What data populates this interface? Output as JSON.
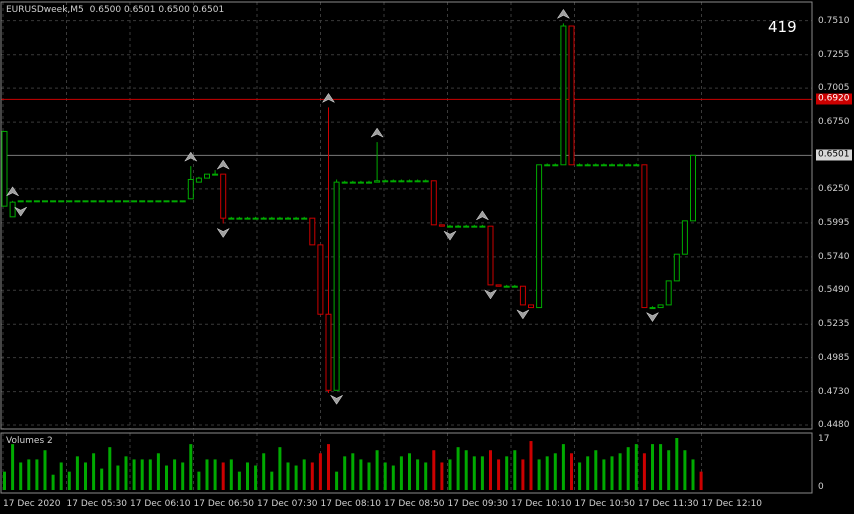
{
  "header": {
    "symbol": "EURUSDweek,M5",
    "ohlc": "0.6500 0.6501 0.6500 0.6501",
    "timer": "419"
  },
  "volume_panel": {
    "title": "Volumes 2",
    "scale": [
      "17",
      "0"
    ]
  },
  "price_axis": {
    "ticks": [
      "0.7510",
      "0.7255",
      "0.7005",
      "0.6750",
      "0.6250",
      "0.5995",
      "0.5740",
      "0.5490",
      "0.5235",
      "0.4985",
      "0.4730",
      "0.4480"
    ],
    "red_line_label": "0.6920",
    "current_price_label": "0.6501"
  },
  "time_axis": {
    "labels": [
      "17 Dec 2020",
      "17 Dec 05:30",
      "17 Dec 06:10",
      "17 Dec 06:50",
      "17 Dec 07:30",
      "17 Dec 08:10",
      "17 Dec 08:50",
      "17 Dec 09:30",
      "17 Dec 10:10",
      "17 Dec 10:50",
      "17 Dec 11:30",
      "17 Dec 12:10"
    ]
  },
  "colors": {
    "background": "#000000",
    "grid": "#3a3a3a",
    "bull": "#00aa00",
    "bear": "#cc0000",
    "red_line": "#cc0000",
    "current_line": "#7a7a7a",
    "fractal": "#a0a0a0"
  },
  "chart_data": [
    {
      "type": "candlestick",
      "title": "EURUSDweek,M5",
      "ylim": [
        0.445,
        0.765
      ],
      "horizontal_lines": [
        0.692,
        0.6501
      ],
      "candles": [
        {
          "o": 0.612,
          "h": 0.668,
          "l": 0.612,
          "c": 0.668
        },
        {
          "o": 0.604,
          "h": 0.616,
          "l": 0.604,
          "c": 0.615
        },
        {
          "o": 0.616,
          "h": 0.616,
          "l": 0.615,
          "c": 0.616
        },
        {
          "o": 0.616,
          "h": 0.616,
          "l": 0.615,
          "c": 0.616
        },
        {
          "o": 0.616,
          "h": 0.616,
          "l": 0.615,
          "c": 0.616
        },
        {
          "o": 0.616,
          "h": 0.616,
          "l": 0.615,
          "c": 0.616
        },
        {
          "o": 0.616,
          "h": 0.616,
          "l": 0.615,
          "c": 0.616
        },
        {
          "o": 0.616,
          "h": 0.616,
          "l": 0.615,
          "c": 0.616
        },
        {
          "o": 0.616,
          "h": 0.616,
          "l": 0.615,
          "c": 0.616
        },
        {
          "o": 0.616,
          "h": 0.616,
          "l": 0.615,
          "c": 0.616
        },
        {
          "o": 0.616,
          "h": 0.616,
          "l": 0.615,
          "c": 0.616
        },
        {
          "o": 0.616,
          "h": 0.616,
          "l": 0.615,
          "c": 0.616
        },
        {
          "o": 0.616,
          "h": 0.616,
          "l": 0.615,
          "c": 0.616
        },
        {
          "o": 0.616,
          "h": 0.616,
          "l": 0.615,
          "c": 0.616
        },
        {
          "o": 0.616,
          "h": 0.616,
          "l": 0.615,
          "c": 0.616
        },
        {
          "o": 0.616,
          "h": 0.616,
          "l": 0.615,
          "c": 0.616
        },
        {
          "o": 0.616,
          "h": 0.616,
          "l": 0.615,
          "c": 0.616
        },
        {
          "o": 0.616,
          "h": 0.616,
          "l": 0.615,
          "c": 0.616
        },
        {
          "o": 0.616,
          "h": 0.616,
          "l": 0.615,
          "c": 0.616
        },
        {
          "o": 0.616,
          "h": 0.616,
          "l": 0.615,
          "c": 0.616
        },
        {
          "o": 0.616,
          "h": 0.616,
          "l": 0.615,
          "c": 0.616
        },
        {
          "o": 0.616,
          "h": 0.616,
          "l": 0.615,
          "c": 0.616
        },
        {
          "o": 0.616,
          "h": 0.616,
          "l": 0.615,
          "c": 0.616
        },
        {
          "o": 0.6175,
          "h": 0.642,
          "l": 0.6175,
          "c": 0.632
        },
        {
          "o": 0.63,
          "h": 0.634,
          "l": 0.63,
          "c": 0.633
        },
        {
          "o": 0.633,
          "h": 0.636,
          "l": 0.633,
          "c": 0.636
        },
        {
          "o": 0.636,
          "h": 0.639,
          "l": 0.636,
          "c": 0.636
        },
        {
          "o": 0.636,
          "h": 0.636,
          "l": 0.599,
          "c": 0.603
        },
        {
          "o": 0.603,
          "h": 0.604,
          "l": 0.603,
          "c": 0.603
        },
        {
          "o": 0.603,
          "h": 0.604,
          "l": 0.603,
          "c": 0.603
        },
        {
          "o": 0.603,
          "h": 0.604,
          "l": 0.603,
          "c": 0.603
        },
        {
          "o": 0.603,
          "h": 0.604,
          "l": 0.603,
          "c": 0.603
        },
        {
          "o": 0.603,
          "h": 0.604,
          "l": 0.603,
          "c": 0.603
        },
        {
          "o": 0.603,
          "h": 0.604,
          "l": 0.603,
          "c": 0.603
        },
        {
          "o": 0.603,
          "h": 0.604,
          "l": 0.603,
          "c": 0.603
        },
        {
          "o": 0.603,
          "h": 0.604,
          "l": 0.603,
          "c": 0.603
        },
        {
          "o": 0.603,
          "h": 0.604,
          "l": 0.603,
          "c": 0.603
        },
        {
          "o": 0.603,
          "h": 0.604,
          "l": 0.603,
          "c": 0.603
        },
        {
          "o": 0.603,
          "h": 0.603,
          "l": 0.583,
          "c": 0.583
        },
        {
          "o": 0.583,
          "h": 0.583,
          "l": 0.531,
          "c": 0.531
        },
        {
          "o": 0.531,
          "h": 0.686,
          "l": 0.472,
          "c": 0.474
        },
        {
          "o": 0.474,
          "h": 0.632,
          "l": 0.474,
          "c": 0.63
        },
        {
          "o": 0.63,
          "h": 0.631,
          "l": 0.63,
          "c": 0.63
        },
        {
          "o": 0.63,
          "h": 0.631,
          "l": 0.63,
          "c": 0.63
        },
        {
          "o": 0.63,
          "h": 0.631,
          "l": 0.63,
          "c": 0.63
        },
        {
          "o": 0.63,
          "h": 0.631,
          "l": 0.63,
          "c": 0.63
        },
        {
          "o": 0.63,
          "h": 0.66,
          "l": 0.63,
          "c": 0.631
        },
        {
          "o": 0.631,
          "h": 0.632,
          "l": 0.63,
          "c": 0.631
        },
        {
          "o": 0.631,
          "h": 0.632,
          "l": 0.63,
          "c": 0.631
        },
        {
          "o": 0.631,
          "h": 0.632,
          "l": 0.63,
          "c": 0.631
        },
        {
          "o": 0.631,
          "h": 0.632,
          "l": 0.63,
          "c": 0.631
        },
        {
          "o": 0.631,
          "h": 0.632,
          "l": 0.63,
          "c": 0.631
        },
        {
          "o": 0.631,
          "h": 0.632,
          "l": 0.63,
          "c": 0.631
        },
        {
          "o": 0.631,
          "h": 0.631,
          "l": 0.598,
          "c": 0.598
        },
        {
          "o": 0.598,
          "h": 0.598,
          "l": 0.597,
          "c": 0.597
        },
        {
          "o": 0.597,
          "h": 0.598,
          "l": 0.597,
          "c": 0.597
        },
        {
          "o": 0.597,
          "h": 0.598,
          "l": 0.597,
          "c": 0.597
        },
        {
          "o": 0.597,
          "h": 0.598,
          "l": 0.597,
          "c": 0.597
        },
        {
          "o": 0.597,
          "h": 0.598,
          "l": 0.597,
          "c": 0.597
        },
        {
          "o": 0.597,
          "h": 0.598,
          "l": 0.597,
          "c": 0.597
        },
        {
          "o": 0.597,
          "h": 0.597,
          "l": 0.553,
          "c": 0.553
        },
        {
          "o": 0.553,
          "h": 0.553,
          "l": 0.552,
          "c": 0.552
        },
        {
          "o": 0.552,
          "h": 0.553,
          "l": 0.552,
          "c": 0.552
        },
        {
          "o": 0.552,
          "h": 0.553,
          "l": 0.552,
          "c": 0.552
        },
        {
          "o": 0.552,
          "h": 0.552,
          "l": 0.538,
          "c": 0.538
        },
        {
          "o": 0.538,
          "h": 0.538,
          "l": 0.536,
          "c": 0.536
        },
        {
          "o": 0.536,
          "h": 0.643,
          "l": 0.536,
          "c": 0.643
        },
        {
          "o": 0.643,
          "h": 0.644,
          "l": 0.643,
          "c": 0.643
        },
        {
          "o": 0.643,
          "h": 0.644,
          "l": 0.643,
          "c": 0.643
        },
        {
          "o": 0.643,
          "h": 0.749,
          "l": 0.643,
          "c": 0.747
        },
        {
          "o": 0.747,
          "h": 0.747,
          "l": 0.643,
          "c": 0.643
        },
        {
          "o": 0.643,
          "h": 0.644,
          "l": 0.643,
          "c": 0.643
        },
        {
          "o": 0.643,
          "h": 0.644,
          "l": 0.643,
          "c": 0.643
        },
        {
          "o": 0.643,
          "h": 0.644,
          "l": 0.643,
          "c": 0.643
        },
        {
          "o": 0.643,
          "h": 0.644,
          "l": 0.643,
          "c": 0.643
        },
        {
          "o": 0.643,
          "h": 0.644,
          "l": 0.643,
          "c": 0.643
        },
        {
          "o": 0.643,
          "h": 0.644,
          "l": 0.643,
          "c": 0.643
        },
        {
          "o": 0.643,
          "h": 0.644,
          "l": 0.643,
          "c": 0.643
        },
        {
          "o": 0.643,
          "h": 0.644,
          "l": 0.643,
          "c": 0.643
        },
        {
          "o": 0.643,
          "h": 0.643,
          "l": 0.536,
          "c": 0.536
        },
        {
          "o": 0.536,
          "h": 0.537,
          "l": 0.536,
          "c": 0.536
        },
        {
          "o": 0.536,
          "h": 0.538,
          "l": 0.536,
          "c": 0.538
        },
        {
          "o": 0.538,
          "h": 0.556,
          "l": 0.538,
          "c": 0.556
        },
        {
          "o": 0.556,
          "h": 0.576,
          "l": 0.556,
          "c": 0.576
        },
        {
          "o": 0.576,
          "h": 0.601,
          "l": 0.576,
          "c": 0.601
        },
        {
          "o": 0.601,
          "h": 0.6501,
          "l": 0.601,
          "c": 0.6501
        }
      ],
      "fractals_up": [
        1,
        23,
        27,
        40,
        46,
        59,
        69
      ],
      "fractals_down": [
        2,
        27,
        41,
        55,
        60,
        64,
        80
      ]
    },
    {
      "type": "bar",
      "title": "Volumes 2",
      "ylim": [
        0,
        17
      ],
      "values": [
        6,
        15,
        9,
        10,
        10,
        13,
        5,
        9,
        6,
        11,
        9,
        12,
        7,
        14,
        8,
        11,
        10,
        10,
        10,
        12,
        8,
        10,
        9,
        15,
        6,
        10,
        10,
        9,
        10,
        6,
        9,
        8,
        12,
        6,
        14,
        9,
        8,
        10,
        9,
        12,
        15,
        6,
        11,
        12,
        10,
        9,
        13,
        9,
        8,
        11,
        12,
        10,
        9,
        13,
        9,
        10,
        14,
        13,
        11,
        11,
        13,
        10,
        11,
        13,
        10,
        16,
        10,
        11,
        12,
        15,
        12,
        9,
        11,
        13,
        10,
        11,
        12,
        14,
        15,
        12,
        15,
        15,
        13,
        17,
        13,
        10,
        6
      ]
    }
  ]
}
